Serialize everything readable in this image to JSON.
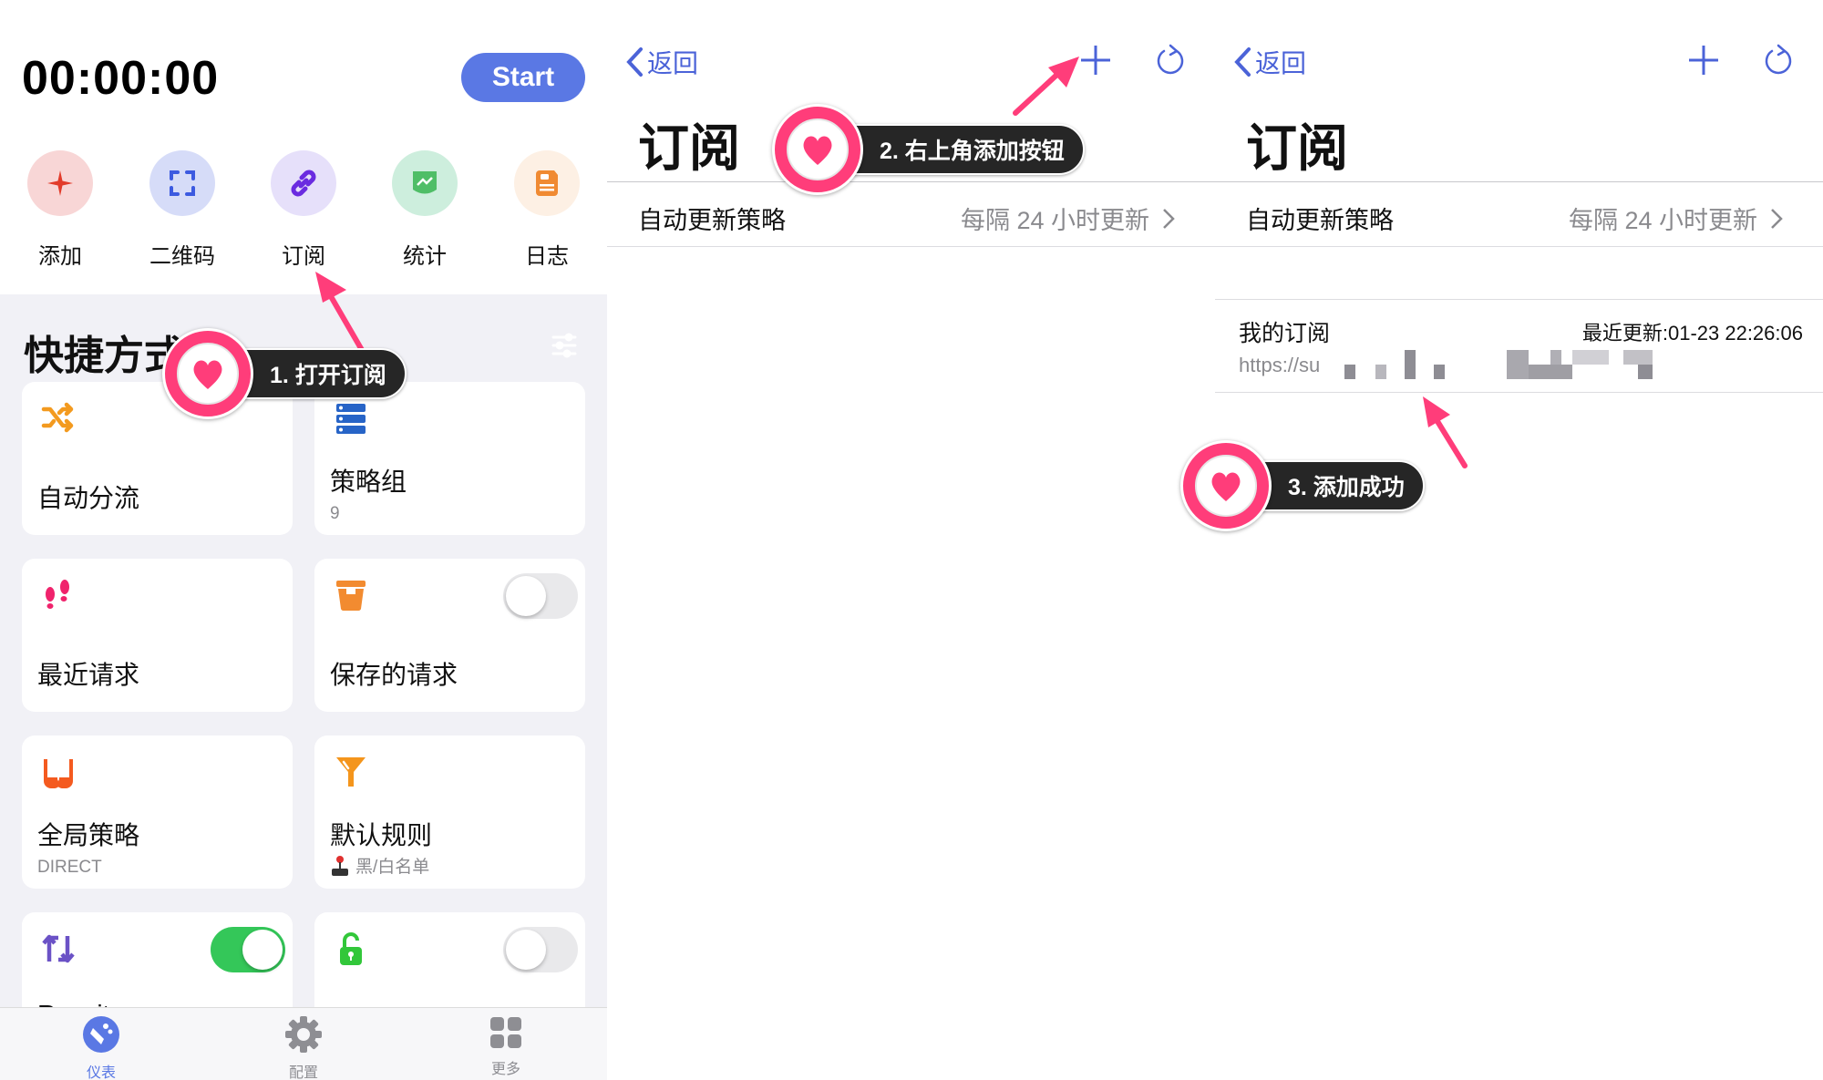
{
  "panel1": {
    "timer": "00:00:00",
    "start_label": "Start",
    "quick_actions": [
      {
        "icon": "plus-icon",
        "label": "添加",
        "bg": "#f8d6d6",
        "fg": "#e23b2a"
      },
      {
        "icon": "qrcode-scan-icon",
        "label": "二维码",
        "bg": "#d6dcf8",
        "fg": "#3c5ae0"
      },
      {
        "icon": "link-icon",
        "label": "订阅",
        "bg": "#e6e0fa",
        "fg": "#6a2be0"
      },
      {
        "icon": "chart-icon",
        "label": "统计",
        "bg": "#cdeedd",
        "fg": "#4fbe67"
      },
      {
        "icon": "log-icon",
        "label": "日志",
        "bg": "#fdf0e4",
        "fg": "#f08a32"
      }
    ],
    "section_title": "快捷方式",
    "cards": [
      {
        "icon": "shuffle-icon",
        "title": "自动分流",
        "subtitle": null,
        "toggle": null,
        "color": "#f39a1f"
      },
      {
        "icon": "server-stack-icon",
        "title": "策略组",
        "subtitle": "9",
        "toggle": null,
        "color": "#2764c7"
      },
      {
        "icon": "footprints-icon",
        "title": "最近请求",
        "subtitle": null,
        "toggle": null,
        "color": "#f0236c"
      },
      {
        "icon": "bucket-icon",
        "title": "保存的请求",
        "subtitle": null,
        "toggle": "off",
        "color": "#f28b30"
      },
      {
        "icon": "glasses-icon",
        "title": "全局策略",
        "subtitle": "DIRECT",
        "toggle": null,
        "color": "#f45a1f"
      },
      {
        "icon": "funnel-icon",
        "title": "默认规则",
        "subtitle": "黑/白名单",
        "subtitle_icon": "joystick-icon",
        "toggle": null,
        "color": "#f4951c"
      },
      {
        "icon": "rewrite-arrows-icon",
        "title": "Rewrite",
        "subtitle": null,
        "toggle": "on",
        "color": "#6b52c6"
      },
      {
        "icon": "unlock-icon",
        "title": "",
        "subtitle": null,
        "toggle": "off",
        "color": "#32c73a"
      }
    ],
    "tabs": [
      {
        "icon": "dashboard-icon",
        "label": "仪表",
        "active": true
      },
      {
        "icon": "gear-icon",
        "label": "配置",
        "active": false
      },
      {
        "icon": "grid-icon",
        "label": "更多",
        "active": false
      }
    ],
    "accent": "#5a78e4"
  },
  "panel2": {
    "back_label": "返回",
    "title": "订阅",
    "auto_update_label": "自动更新策略",
    "auto_update_value": "每隔 24 小时更新"
  },
  "panel3": {
    "back_label": "返回",
    "title": "订阅",
    "auto_update_label": "自动更新策略",
    "auto_update_value": "每隔 24 小时更新",
    "subscription": {
      "name": "我的订阅",
      "last_updated": "最近更新:01-23 22:26:06",
      "url_visible": "https://su"
    }
  },
  "annotations": [
    {
      "step": "1. 打开订阅"
    },
    {
      "step": "2. 右上角添加按钮"
    },
    {
      "step": "3. 添加成功"
    }
  ],
  "annotation_color": "#ff3d7a"
}
